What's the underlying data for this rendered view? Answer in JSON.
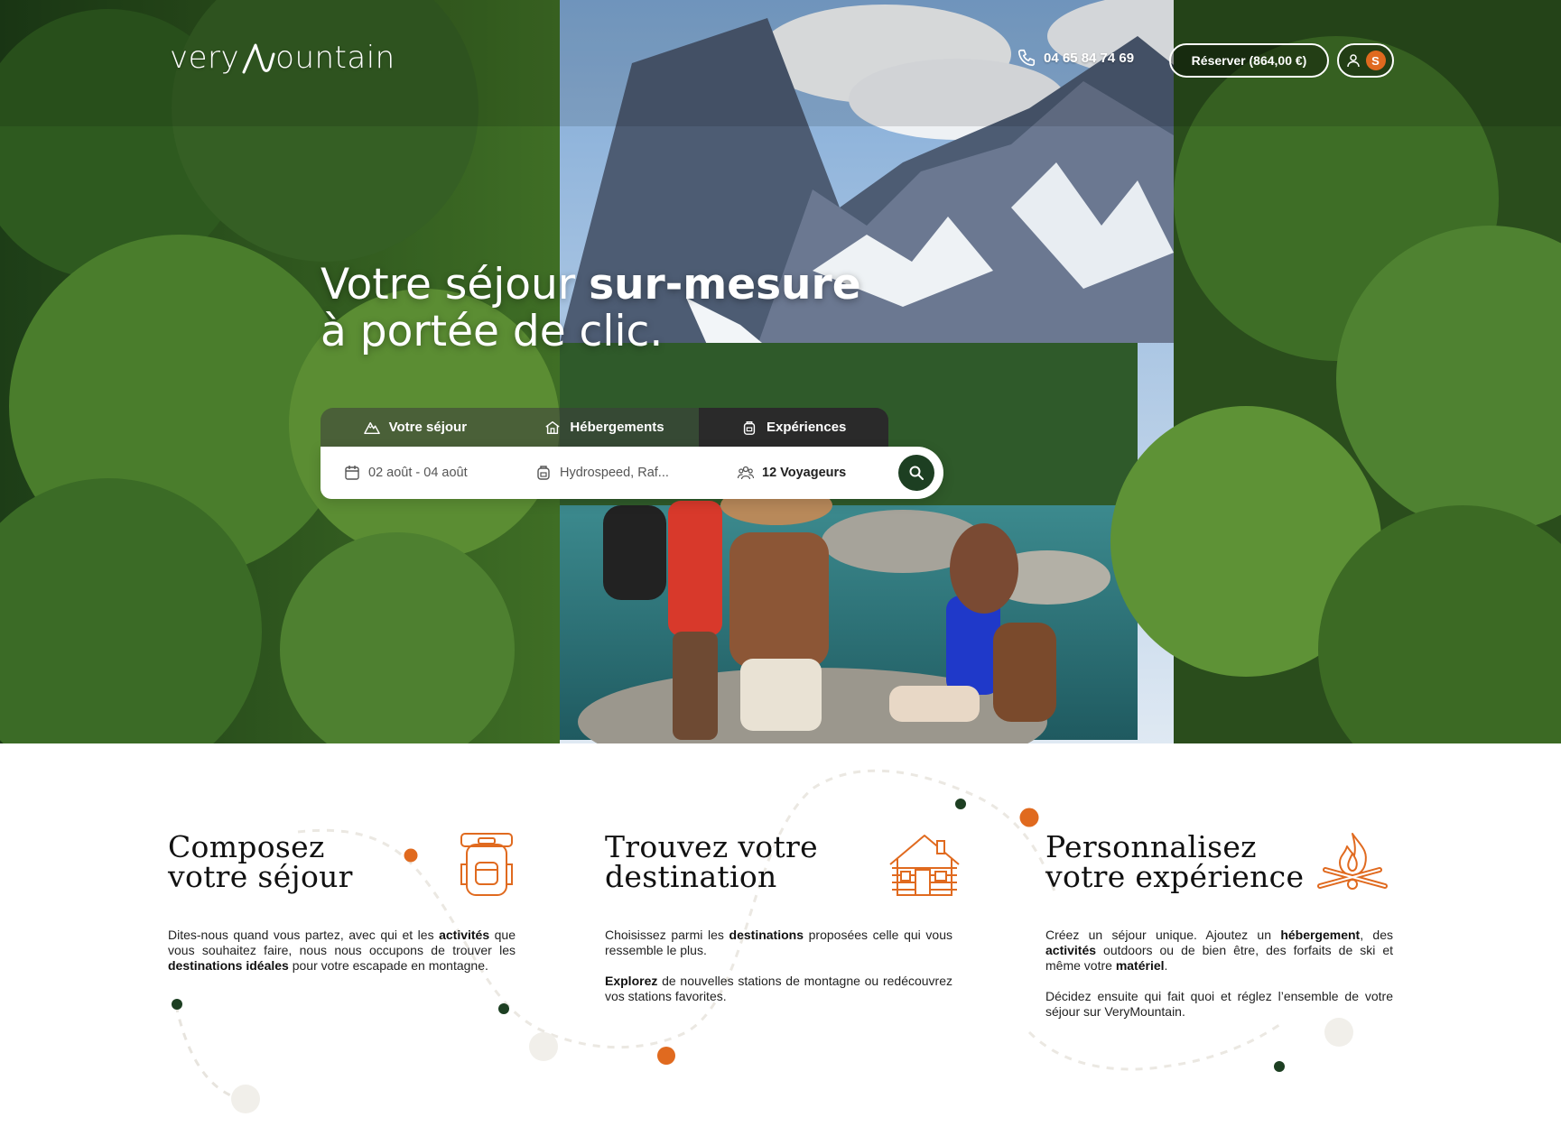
{
  "brand": {
    "logo_prefix": "very",
    "logo_suffix": "ountain"
  },
  "header": {
    "phone": "04 65 84 74 69",
    "reserve_label": "Réserver (864,00 €)",
    "avatar_initial": "S"
  },
  "hero": {
    "title_line1_regular": "Votre séjour ",
    "title_line1_bold": "sur-mesure",
    "title_line2": "à portée de clic."
  },
  "search": {
    "tabs": [
      {
        "label": "Votre séjour",
        "icon": "mountain-icon"
      },
      {
        "label": "Hébergements",
        "icon": "house-icon"
      },
      {
        "label": "Expériences",
        "icon": "backpack-icon"
      }
    ],
    "dates_value": "02 août - 04 août",
    "activity_value": "Hydrospeed, Raf...",
    "travelers_value": "12 Voyageurs"
  },
  "features": [
    {
      "title_l1": "Composez",
      "title_l2": "votre séjour",
      "icon": "backpack-icon",
      "p1": [
        "Dites-nous quand vous partez, avec qui et les ",
        "activités",
        " que vous souhaitez faire, nous nous occupons de trouver les ",
        "destinations idéales",
        " pour votre escapade en montagne."
      ]
    },
    {
      "title_l1": "Trouvez votre",
      "title_l2": "destination",
      "icon": "cabin-icon",
      "p1": [
        "Choisissez parmi les ",
        "destinations",
        " proposées celle qui vous ressemble le plus."
      ],
      "p2": [
        "Explorez",
        " de nouvelles stations de montagne ou redécouvrez vos stations favorites."
      ]
    },
    {
      "title_l1": "Personnalisez",
      "title_l2": "votre expérience",
      "icon": "campfire-icon",
      "p1": [
        "Créez un séjour unique. Ajoutez un ",
        "hébergement",
        ", des ",
        "activités",
        " outdoors ou de bien être, des forfaits de ski et même votre ",
        "matériel",
        "."
      ],
      "p2": [
        "Décidez ensuite qui fait quoi et réglez l’ensemble de votre séjour sur VeryMountain."
      ]
    }
  ],
  "colors": {
    "accent_orange": "#e06a1f",
    "dark_green": "#1d3f22",
    "text_dark": "#111111"
  }
}
